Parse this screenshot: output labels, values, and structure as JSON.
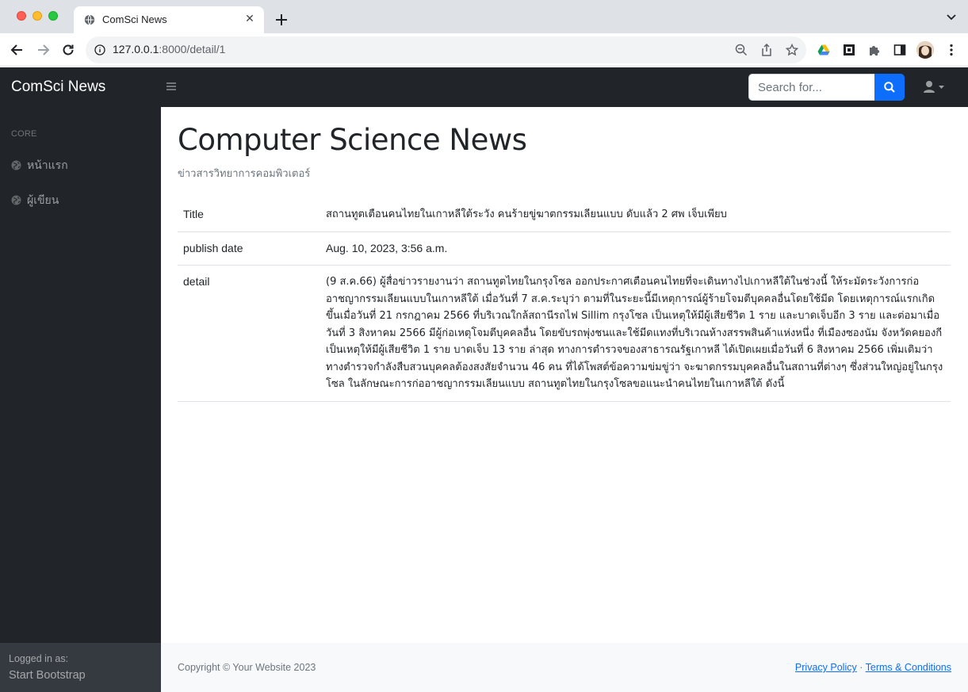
{
  "browser": {
    "tab_title": "ComSci News",
    "url_host": "127.0.0.1",
    "url_rest": ":8000/detail/1"
  },
  "navbar": {
    "brand": "ComSci News",
    "search_placeholder": "Search for..."
  },
  "sidebar": {
    "heading": "Core",
    "items": [
      {
        "label": "หน้าแรก",
        "icon": "globe-icon"
      },
      {
        "label": "ผู้เขียน",
        "icon": "globe-icon"
      }
    ],
    "footer": {
      "logged_in_label": "Logged in as:",
      "user": "Start Bootstrap"
    }
  },
  "main": {
    "title": "Computer Science News",
    "subtitle": "ข่าวสารวิทยาการคอมพิวเตอร์",
    "rows": [
      {
        "key": "Title",
        "value": "สถานทูตเตือนคนไทยในเกาหลีใต้ระวัง คนร้ายขู่ฆาตกรรมเลียนแบบ ดับแล้ว 2 ศพ เจ็บเพียบ"
      },
      {
        "key": "publish date",
        "value": "Aug. 10, 2023, 3:56 a.m."
      },
      {
        "key": "detail",
        "value": "(9 ส.ค.66) ผู้สื่อข่าวรายงานว่า สถานทูตไทยในกรุงโซล ออกประกาศเตือนคนไทยที่จะเดินทางไปเกาหลีใต้ในช่วงนี้ ให้ระมัดระวังการก่ออาชญากรรมเลียนแบบในเกาหลีใต้ เมื่อวันที่ 7 ส.ค.ระบุว่า ตามที่ในระยะนี้มีเหตุการณ์ผู้ร้ายโจมตีบุคคลอื่นโดยใช้มีด โดยเหตุการณ์แรกเกิดขึ้นเมื่อวันที่ 21 กรกฎาคม 2566 ที่บริเวณใกล้สถานีรถไฟ Sillim กรุงโซล เป็นเหตุให้มีผู้เสียชีวิต 1 ราย และบาดเจ็บอีก 3 ราย และต่อมาเมื่อวันที่ 3 สิงหาคม 2566 มีผู้ก่อเหตุโจมตีบุคคลอื่น โดยขับรถพุ่งชนและใช้มีดแทงที่บริเวณห้างสรรพสินค้าแห่งหนึ่ง ที่เมืองซองนัม จังหวัดคยองกี เป็นเหตุให้มีผู้เสียชีวิต 1 ราย บาดเจ็บ 13 ราย ล่าสุด ทางการตำรวจของสาธารณรัฐเกาหลี ได้เปิดเผยเมื่อวันที่ 6 สิงหาคม 2566 เพิ่มเติมว่า ทางตำรวจกำลังสืบสวนบุคคลต้องสงสัยจำนวน 46 คน ที่ได้โพสต์ข้อความข่มขู่ว่า จะฆาตกรรมบุคคลอื่นในสถานที่ต่างๆ ซึ่งส่วนใหญ่อยู่ในกรุงโซล ในลักษณะการก่ออาชญากรรมเลียนแบบ สถานทูตไทยในกรุงโซลขอแนะนำคนไทยในเกาหลีใต้ ดังนี้"
      }
    ]
  },
  "footer": {
    "copyright": "Copyright © Your Website 2023",
    "privacy": "Privacy Policy",
    "separator": "·",
    "terms": "Terms & Conditions"
  },
  "colors": {
    "dark": "#212529",
    "primary": "#0d6efd",
    "footer_bg": "#f8f9fa"
  }
}
